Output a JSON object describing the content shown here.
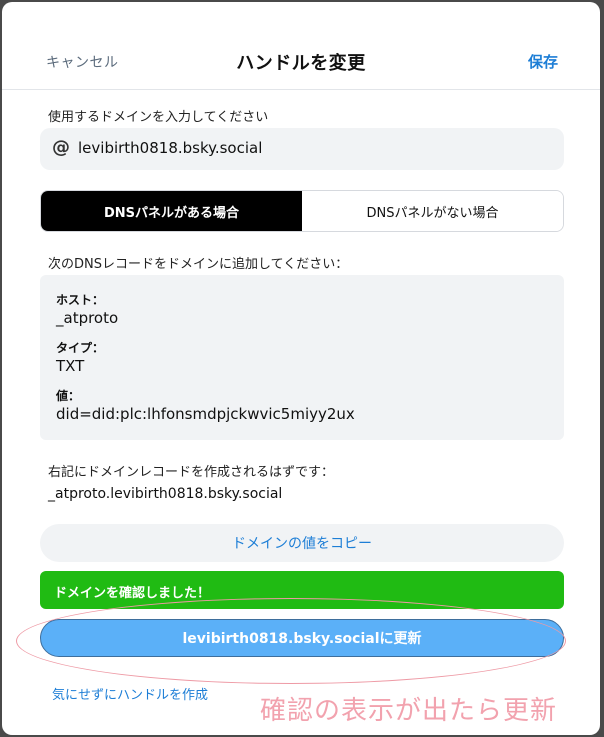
{
  "header": {
    "cancel_label": "キャンセル",
    "title": "ハンドルを変更",
    "save_label": "保存"
  },
  "domain_input": {
    "label": "使用するドメインを入力してください",
    "value": "levibirth0818.bsky.social",
    "icon": "at-icon"
  },
  "tabs": [
    {
      "label": "DNSパネルがある場合",
      "active": true
    },
    {
      "label": "DNSパネルがない場合",
      "active": false
    }
  ],
  "record": {
    "instruction": "次のDNSレコードをドメインに追加してください：",
    "host_label": "ホスト：",
    "host_value": "_atproto",
    "type_label": "タイプ：",
    "type_value": "TXT",
    "value_label": "値：",
    "value_value": "did=did:plc:lhfonsmdpjckwvic5miyy2ux"
  },
  "expected": {
    "label": "右記にドメインレコードを作成されるはずです：",
    "value": "_atproto.levibirth0818.bsky.social"
  },
  "copy_button_label": "ドメインの値をコピー",
  "verified_message": "ドメインを確認しました！",
  "update_button_label": "levibirth0818.bsky.socialに更新",
  "ignore_link_label": "気にせずにハンドルを作成",
  "annotation_text": "確認の表示が出たら更新",
  "colors": {
    "accent": "#1d7ed6",
    "success": "#20bb13",
    "update_button": "#5bb0f8",
    "annotation": "#f2a2ae"
  }
}
